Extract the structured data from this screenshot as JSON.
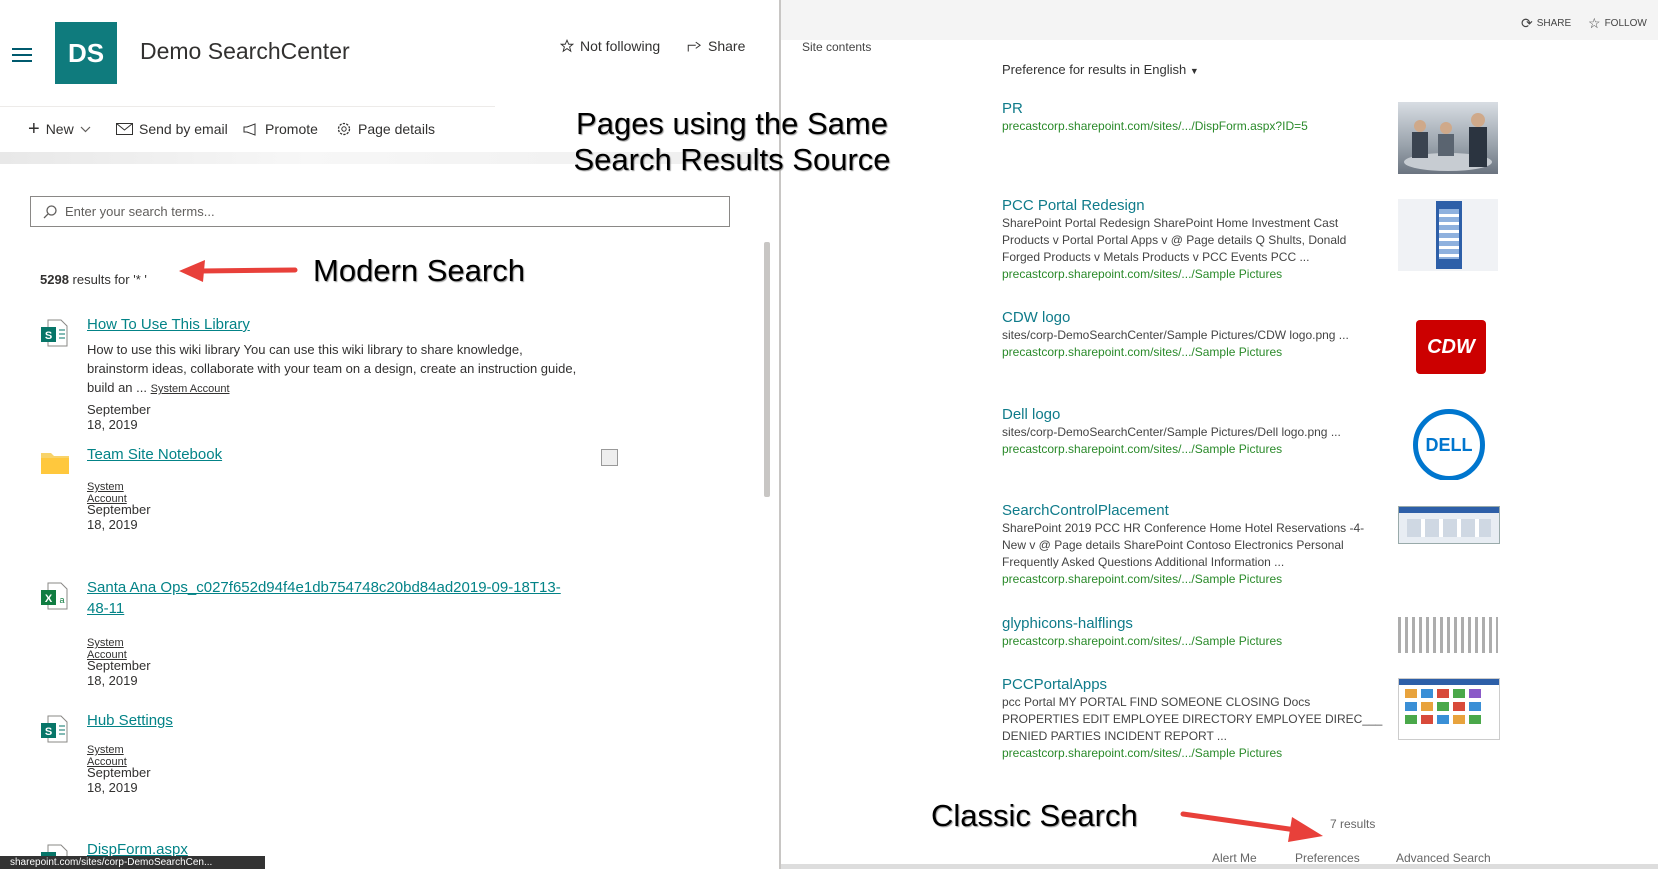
{
  "modern": {
    "header": {
      "logo_text": "DS",
      "site_title": "Demo SearchCenter",
      "follow_label": "Not following",
      "share_label": "Share"
    },
    "commandbar": {
      "new_label": "New",
      "email_label": "Send by email",
      "promote_label": "Promote",
      "details_label": "Page details"
    },
    "search": {
      "placeholder": "Enter your search terms..."
    },
    "results_count": "5298",
    "results_suffix": " results for '* '",
    "results": [
      {
        "title": "How To Use This Library",
        "icon": "sharepoint-page-icon",
        "description": "How to use this wiki library You can use this wiki library to share knowledge, brainstorm ideas, collaborate with your team on a design, create an instruction guide, build an ...",
        "author": "System Account",
        "date": "September 18, 2019"
      },
      {
        "title": "Team Site Notebook",
        "icon": "folder-icon",
        "description": "",
        "author": "System Account",
        "date": "September 18, 2019"
      },
      {
        "title": "Santa Ana Ops_c027f652d94f4e1db754748c20bd84ad2019-09-18T13-48-11",
        "title_line2": "48-11",
        "title_line1": "Santa Ana Ops_c027f652d94f4e1db754748c20bd84ad2019-09-18T13-",
        "icon": "excel-file-icon",
        "description": "",
        "author": "System Account",
        "date": "September 18, 2019"
      },
      {
        "title": "Hub Settings",
        "icon": "sharepoint-page-icon",
        "description": "",
        "author": "System Account",
        "date": "September 18, 2019"
      },
      {
        "title": "DispForm.aspx",
        "icon": "sharepoint-page-icon"
      }
    ],
    "status_url": "sharepoint.com/sites/corp-DemoSearchCen..."
  },
  "classic": {
    "share_label": "SHARE",
    "follow_label": "FOLLOW",
    "site_contents": "Site contents",
    "preference_prefix": "Preference for results in",
    "preference_lang": "English",
    "results": [
      {
        "title": "PR",
        "description": "",
        "url": "precastcorp.sharepoint.com/sites/.../DispForm.aspx?ID=5",
        "thumb": "meeting-photo"
      },
      {
        "title": "PCC Portal Redesign",
        "description": "SharePoint Portal Redesign SharePoint Home Investment Cast Products v Portal Portal Apps v @ Page details Q Shults, Donald Forged Products v Metals Products v PCC Events PCC ...",
        "url": "precastcorp.sharepoint.com/sites/.../Sample Pictures",
        "thumb": "portal-screenshot"
      },
      {
        "title": "CDW logo",
        "description": "sites/corp-DemoSearchCenter/Sample Pictures/CDW logo.png ...",
        "url": "precastcorp.sharepoint.com/sites/.../Sample Pictures",
        "thumb": "cdw-logo",
        "thumb_text": "CDW"
      },
      {
        "title": "Dell logo",
        "description": "sites/corp-DemoSearchCenter/Sample Pictures/Dell logo.png ...",
        "url": "precastcorp.sharepoint.com/sites/.../Sample Pictures",
        "thumb": "dell-logo",
        "thumb_text": "DELL"
      },
      {
        "title": "SearchControlPlacement",
        "description": "SharePoint 2019 PCC HR Conference Home Hotel Reservations -4- New v @ Page details SharePoint Contoso Electronics Personal Frequently Asked Questions Additional Information ...",
        "url": "precastcorp.sharepoint.com/sites/.../Sample Pictures",
        "thumb": "page-screenshot"
      },
      {
        "title": "glyphicons-halflings",
        "description": "",
        "url": "precastcorp.sharepoint.com/sites/.../Sample Pictures",
        "thumb": "glyph-grid"
      },
      {
        "title": "PCCPortalApps",
        "description": "pcc Portal MY PORTAL FIND SOMEONE CLOSING Docs PROPERTIES EDIT EMPLOYEE DIRECTORY EMPLOYEE DIREC___ DENIED PARTIES INCIDENT REPORT ...",
        "url": "precastcorp.sharepoint.com/sites/.../Sample Pictures",
        "thumb": "apps-tiles"
      }
    ],
    "result_count": "7 results",
    "footer": {
      "alert": "Alert Me",
      "preferences": "Preferences",
      "advanced": "Advanced Search"
    }
  },
  "annotations": {
    "top_line1": "Pages using the Same",
    "top_line2": "Search Results Source",
    "modern": "Modern Search",
    "classic": "Classic Search"
  },
  "colors": {
    "accent": "#0f7b7d",
    "link": "#038387",
    "url_green": "#2a8a2a",
    "arrow": "#e8403a"
  }
}
